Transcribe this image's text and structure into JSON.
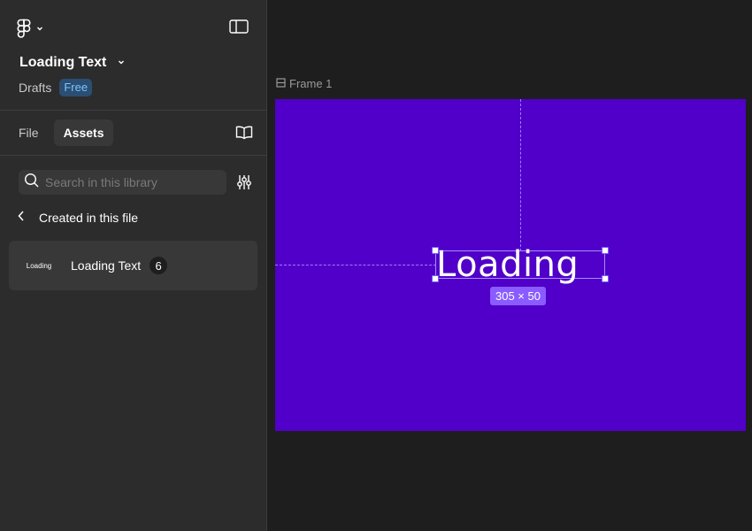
{
  "header": {
    "logo_icon": "figma-logo-icon",
    "file_title": "Loading Text",
    "location": "Drafts",
    "plan_badge": "Free"
  },
  "tabs": [
    {
      "label": "File",
      "active": false
    },
    {
      "label": "Assets",
      "active": true
    }
  ],
  "search": {
    "placeholder": "Search in this library"
  },
  "back_row": {
    "label": "Created in this file"
  },
  "asset": {
    "thumbnail_text": "Loading",
    "name": "Loading Text",
    "count": "6"
  },
  "canvas": {
    "frame_label": "Frame 1",
    "frame_color": "#5000c8",
    "selected_text": "Loading",
    "dimension_badge": "305 × 50"
  },
  "colors": {
    "sidebar_bg": "#2c2c2c",
    "canvas_bg": "#1e1e1e",
    "selection_accent": "#8a5cff",
    "badge_blue": "#7cc4fa"
  }
}
